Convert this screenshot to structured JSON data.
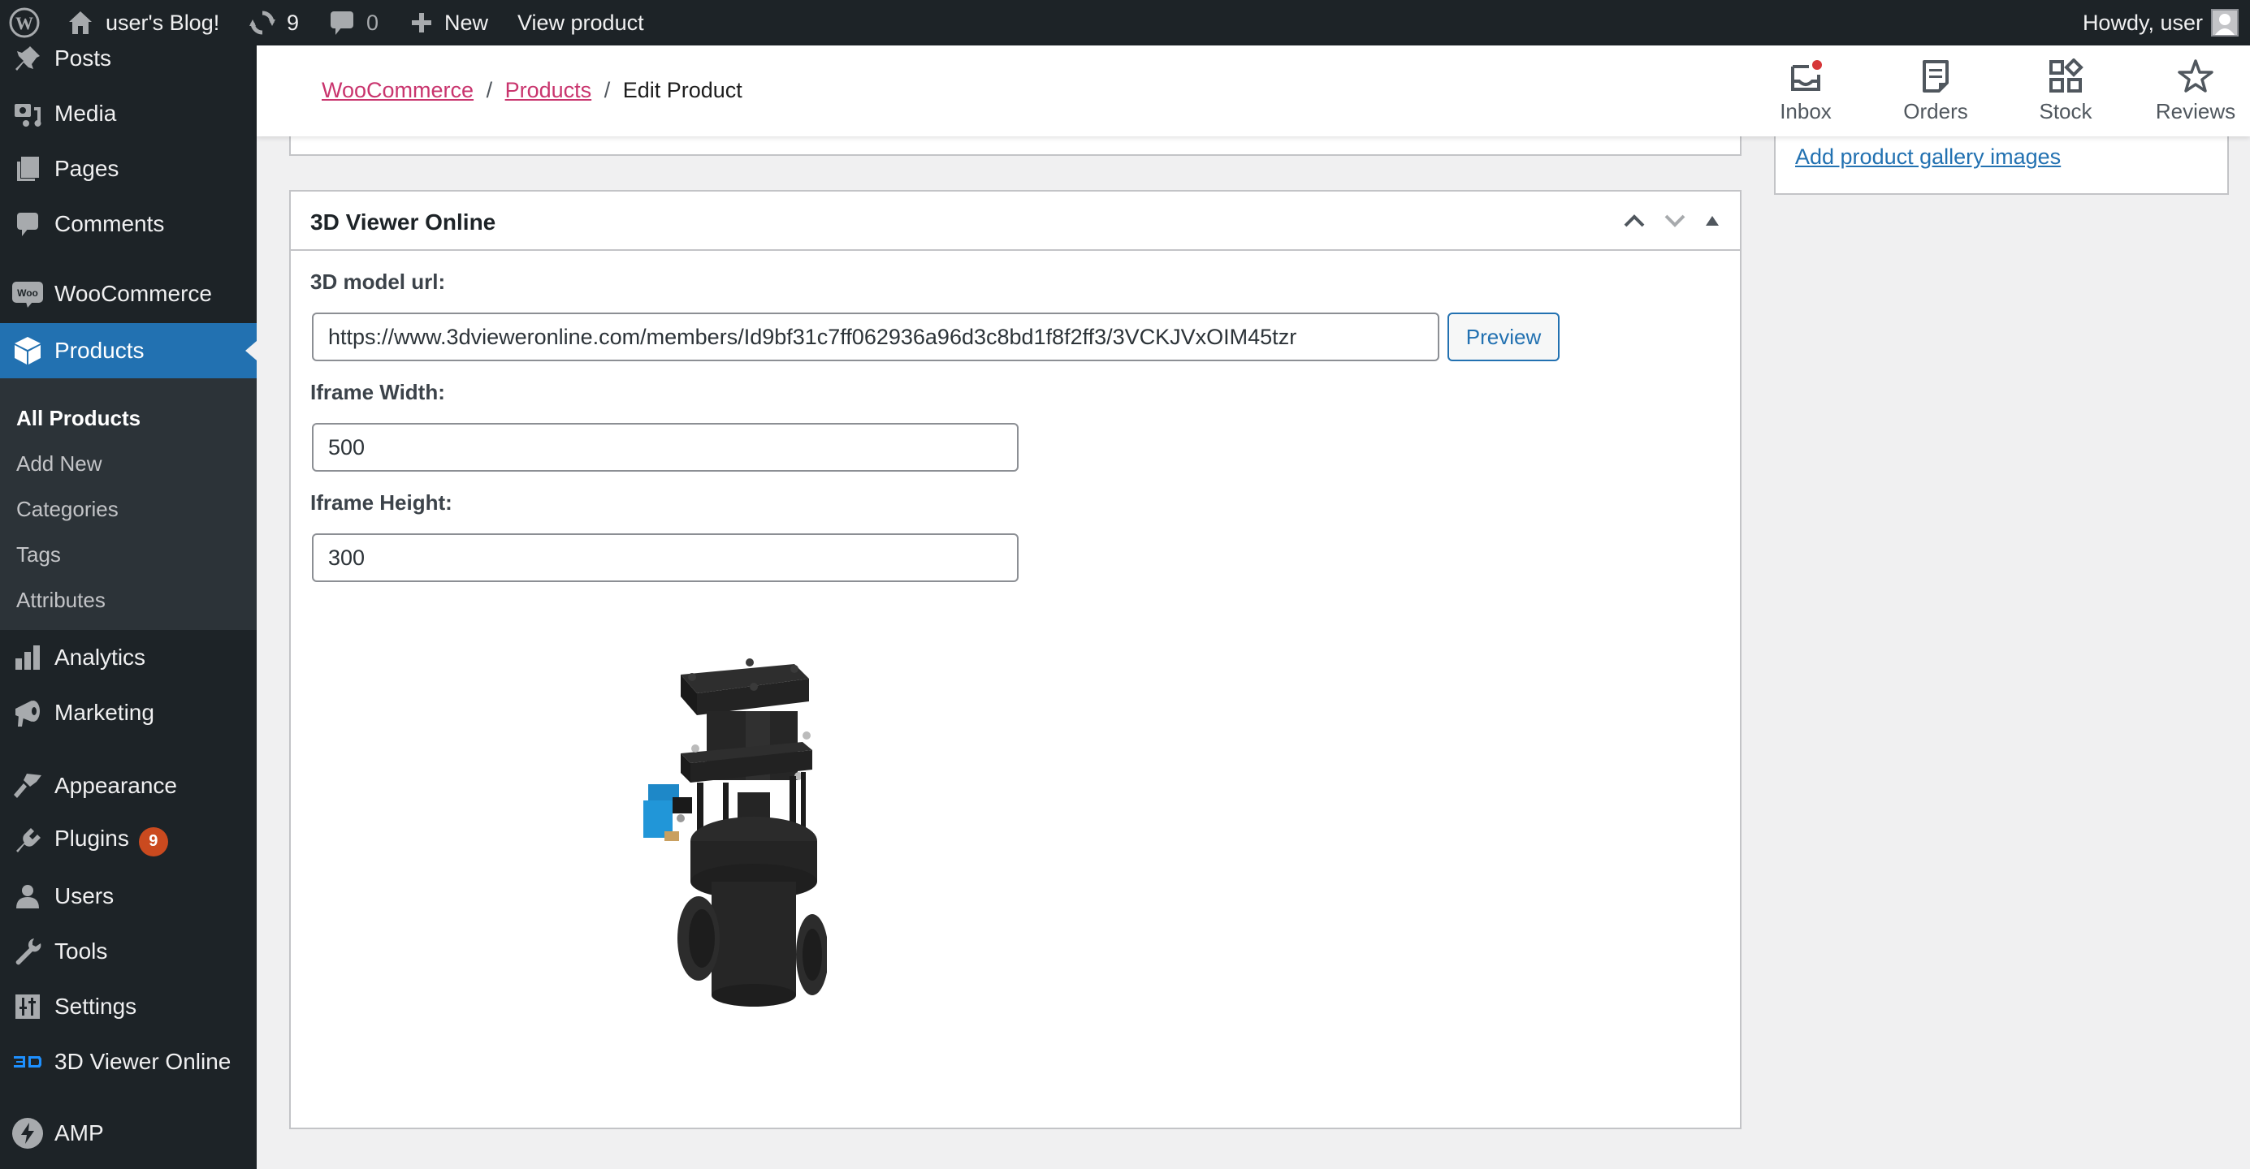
{
  "adminbar": {
    "site_name": "user's Blog!",
    "updates_count": "9",
    "comments_count": "0",
    "new_label": "New",
    "view_product_label": "View product",
    "howdy": "Howdy, user"
  },
  "sidebar": {
    "items": [
      {
        "label": "Posts",
        "icon": "pushpin-icon"
      },
      {
        "label": "Media",
        "icon": "media-icon"
      },
      {
        "label": "Pages",
        "icon": "pages-icon"
      },
      {
        "label": "Comments",
        "icon": "comment-icon"
      },
      {
        "label": "WooCommerce",
        "icon": "woo-icon"
      },
      {
        "label": "Products",
        "icon": "box-icon",
        "current": true
      },
      {
        "label": "Analytics",
        "icon": "bar-chart-icon"
      },
      {
        "label": "Marketing",
        "icon": "megaphone-icon"
      },
      {
        "label": "Appearance",
        "icon": "paintbrush-icon"
      },
      {
        "label": "Plugins",
        "icon": "plug-icon",
        "badge": "9"
      },
      {
        "label": "Users",
        "icon": "user-icon"
      },
      {
        "label": "Tools",
        "icon": "wrench-icon"
      },
      {
        "label": "Settings",
        "icon": "sliders-icon"
      },
      {
        "label": "3D Viewer Online",
        "icon": "3d-logo-icon"
      },
      {
        "label": "AMP",
        "icon": "amp-bolt-icon"
      }
    ],
    "submenu": [
      {
        "label": "All Products",
        "current": true
      },
      {
        "label": "Add New"
      },
      {
        "label": "Categories"
      },
      {
        "label": "Tags"
      },
      {
        "label": "Attributes"
      }
    ]
  },
  "header": {
    "breadcrumb": [
      {
        "label": "WooCommerce",
        "link": true
      },
      {
        "label": "Products",
        "link": true
      },
      {
        "label": "Edit Product",
        "link": false
      }
    ],
    "separator": "/",
    "activity": [
      {
        "label": "Inbox",
        "icon": "inbox-icon",
        "unread": true
      },
      {
        "label": "Orders",
        "icon": "orders-icon"
      },
      {
        "label": "Stock",
        "icon": "stock-icon"
      },
      {
        "label": "Reviews",
        "icon": "star-icon"
      }
    ]
  },
  "right_panel": {
    "gallery_link": "Add product gallery images"
  },
  "metabox": {
    "title": "3D Viewer Online",
    "url_label": "3D model url:",
    "url_value": "https://www.3dvieweronline.com/members/Id9bf31c7ff062936a96d3c8bd1f8f2ff3/3VCKJVxOIM45tzr",
    "preview_label": "Preview",
    "width_label": "Iframe Width:",
    "width_value": "500",
    "height_label": "Iframe Height:",
    "height_value": "300",
    "preview_model": "valve-3d-model"
  },
  "colors": {
    "adminbar_bg": "#1d2327",
    "accent": "#2271b1",
    "woo_link": "#c9356e",
    "badge": "#ca4a1f"
  }
}
